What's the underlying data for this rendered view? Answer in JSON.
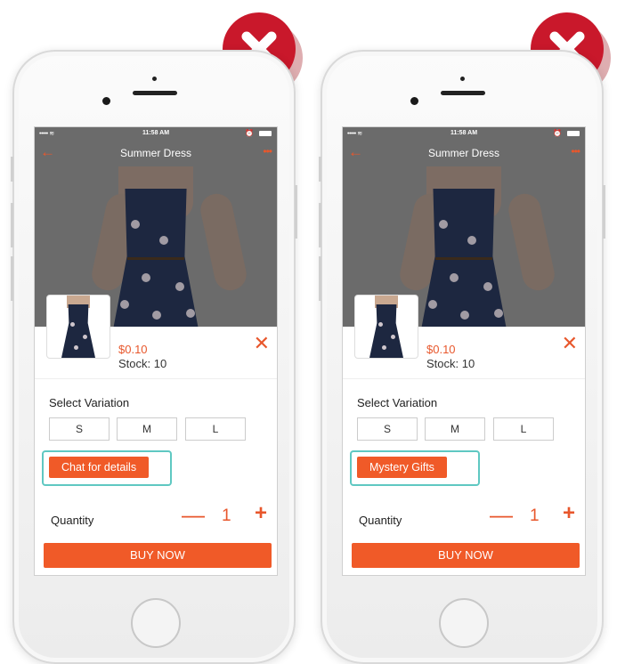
{
  "colors": {
    "accent": "#f05a28",
    "highlight": "#5fc8c2",
    "reject": "#c9182b"
  },
  "icons": {
    "reject": "x-mark-icon",
    "back": "back-arrow-icon",
    "more": "more-dots-icon",
    "close": "close-icon"
  },
  "phones": [
    {
      "status": {
        "time": "11:58 AM",
        "carrier": "••••• ≋"
      },
      "nav": {
        "back": "←",
        "title": "Summer Dress",
        "more": "•••"
      },
      "product": {
        "price": "$0.10",
        "stock": "Stock: 10",
        "close": "✕"
      },
      "variation": {
        "label": "Select Variation",
        "sizes": [
          "S",
          "M",
          "L"
        ]
      },
      "variant_button": "Chat for details",
      "quantity": {
        "label": "Quantity",
        "minus": "—",
        "value": "1",
        "plus": "+"
      },
      "buy": "BUY NOW"
    },
    {
      "status": {
        "time": "11:58 AM",
        "carrier": "••••• ≋"
      },
      "nav": {
        "back": "←",
        "title": "Summer Dress",
        "more": "•••"
      },
      "product": {
        "price": "$0.10",
        "stock": "Stock: 10",
        "close": "✕"
      },
      "variation": {
        "label": "Select Variation",
        "sizes": [
          "S",
          "M",
          "L"
        ]
      },
      "variant_button": "Mystery Gifts",
      "quantity": {
        "label": "Quantity",
        "minus": "—",
        "value": "1",
        "plus": "+"
      },
      "buy": "BUY NOW"
    }
  ]
}
